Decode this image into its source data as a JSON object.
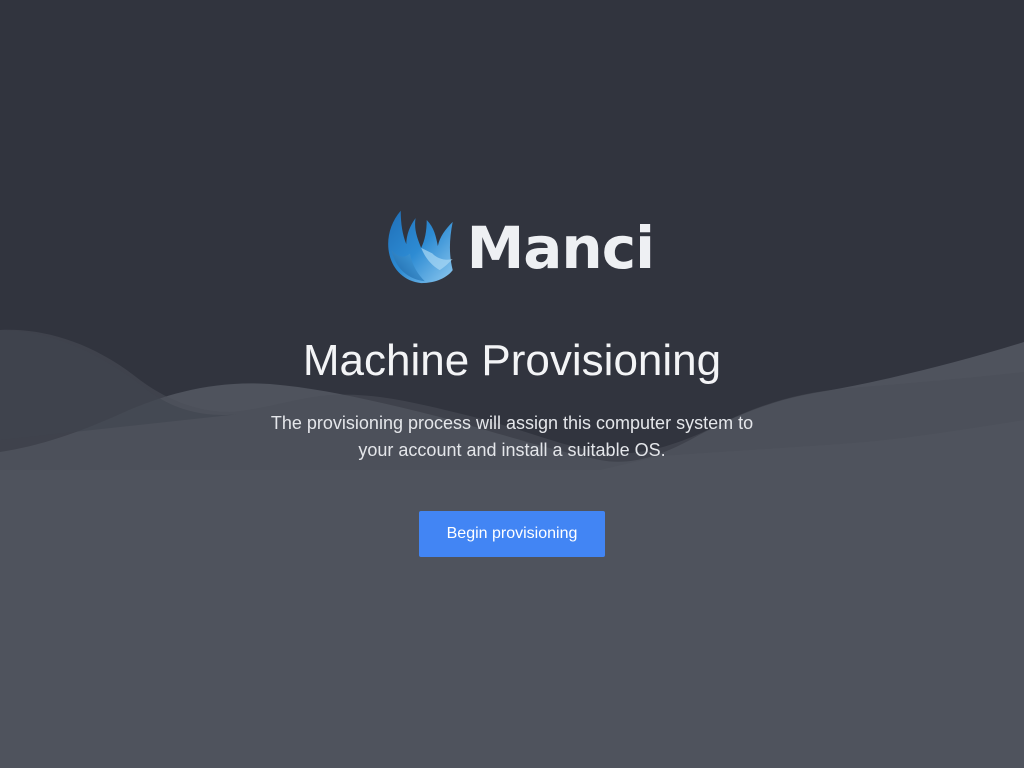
{
  "brand": {
    "name": "Manci",
    "icon": "flame-logo-icon",
    "accent_color": "#2d8bd3"
  },
  "heading": "Machine Provisioning",
  "description": "The provisioning process will assign this computer system to your account and install a suitable OS.",
  "actions": {
    "begin_label": "Begin provisioning",
    "begin_color": "#4285f4"
  },
  "theme": {
    "background_top": "#31343e",
    "background_bottom": "#4f535d"
  }
}
